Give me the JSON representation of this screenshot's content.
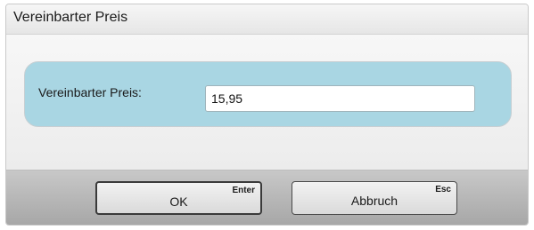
{
  "dialog": {
    "title": "Vereinbarter Preis"
  },
  "form": {
    "price_label": "Vereinbarter Preis:",
    "price_value": "15,95"
  },
  "buttons": {
    "ok": {
      "label": "OK",
      "shortcut": "Enter"
    },
    "cancel": {
      "label": "Abbruch",
      "shortcut": "Esc"
    }
  },
  "colors": {
    "panel_background": "#a9d6e3",
    "footer_background": "#b5b5b5"
  }
}
